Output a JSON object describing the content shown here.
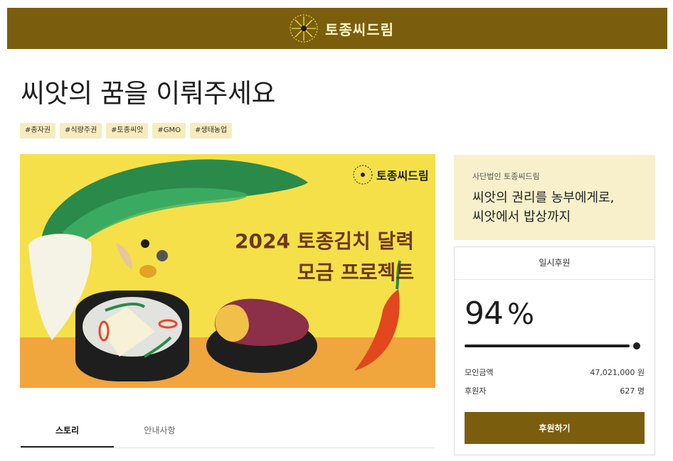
{
  "header": {
    "brand_name": "토종씨드림",
    "logo_icon": "dandelion-seed-icon"
  },
  "project": {
    "title": "씨앗의 꿈을 이뤄주세요",
    "tags": [
      "#종자권",
      "#식량주권",
      "#토종씨앗",
      "#GMO",
      "#생태농업"
    ]
  },
  "hero": {
    "brand_name": "토종씨드림",
    "line1": "2024 토종김치 달력",
    "line2": "모금 프로젝트"
  },
  "tabs": [
    {
      "label": "스토리",
      "active": true
    },
    {
      "label": "안내사항",
      "active": false
    }
  ],
  "organization": {
    "name": "사단법인 토종씨드림",
    "slogan_line1": "씨앗의 권리를 농부에게로,",
    "slogan_line2": "씨앗에서 밥상까지"
  },
  "funding": {
    "type_label": "일시후원",
    "percent": "94",
    "percent_unit": "%",
    "progress_fraction": 0.94,
    "amount_label": "모인금액",
    "amount_value": "47,021,000 원",
    "backers_label": "후원자",
    "backers_value": "627 명",
    "button_label": "후원하기"
  },
  "colors": {
    "brand": "#7a5e0e",
    "tag_bg": "#f7ecbd",
    "org_bg": "#f7f0cb",
    "hero_bg": "#f5e04a"
  }
}
